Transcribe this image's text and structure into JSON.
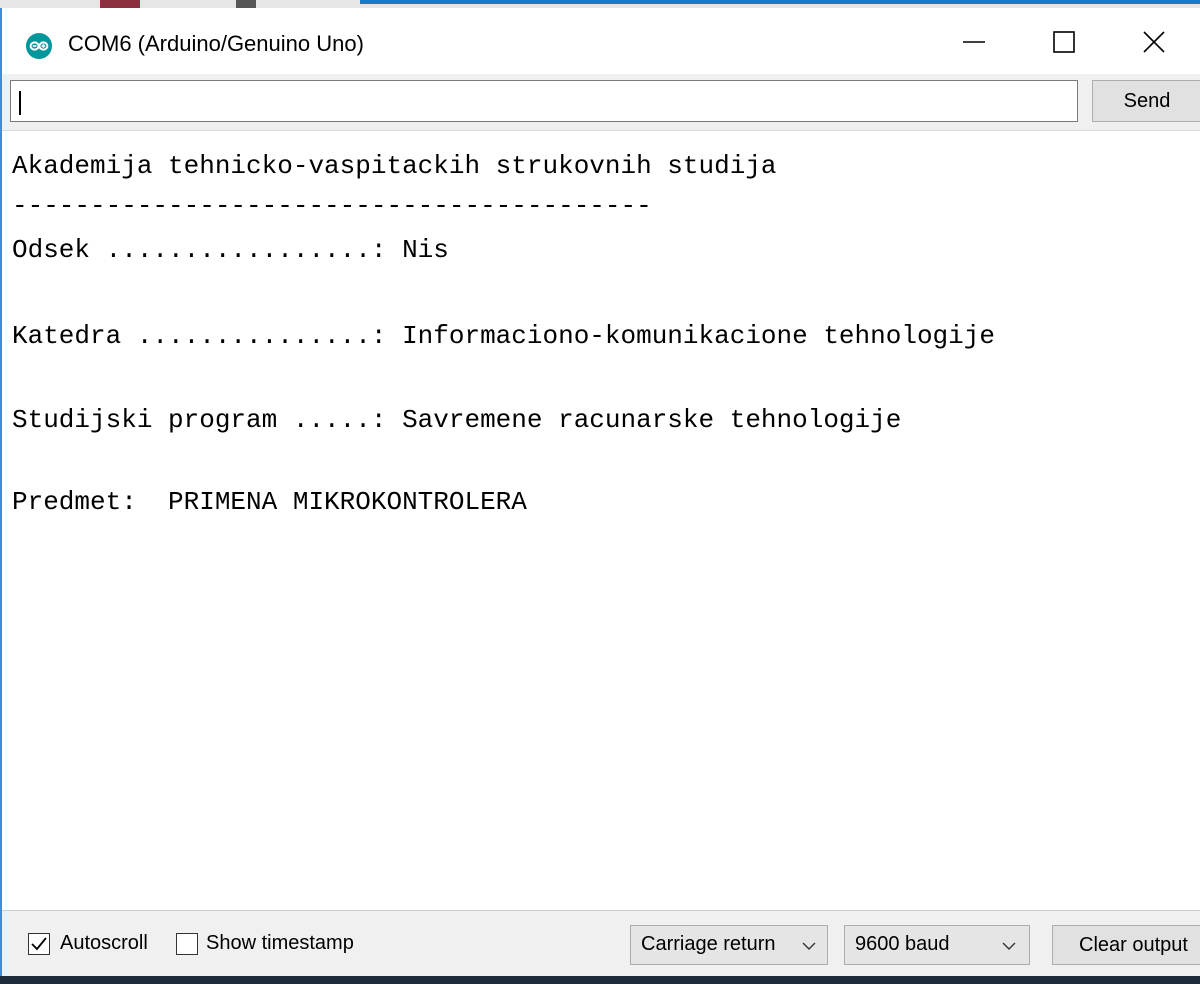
{
  "window": {
    "title": "COM6 (Arduino/Genuino Uno)",
    "app_icon": "arduino-logo-icon",
    "controls": [
      "minimize-icon",
      "maximize-icon",
      "close-icon"
    ]
  },
  "send_bar": {
    "input_value": "",
    "send_label": "Send"
  },
  "output": {
    "lines": [
      "Akademija tehnicko-vaspitackih strukovnih studija",
      "-----------------------------------------",
      "Odsek .................: Nis",
      "Katedra ...............: Informaciono-komunikacione tehnologije",
      "Studijski program .....: Savremene racunarske tehnologije",
      "Predmet:  PRIMENA MIKROKONTROLERA"
    ]
  },
  "status_bar": {
    "autoscroll_label": "Autoscroll",
    "autoscroll_checked": true,
    "timestamp_label": "Show timestamp",
    "timestamp_checked": false,
    "line_ending_selected": "Carriage return",
    "baud_selected": "9600 baud",
    "clear_label": "Clear output"
  },
  "colors": {
    "accent_blue": "#1979ca",
    "arduino_teal": "#00979c",
    "chrome_gray": "#f0f0f0"
  }
}
